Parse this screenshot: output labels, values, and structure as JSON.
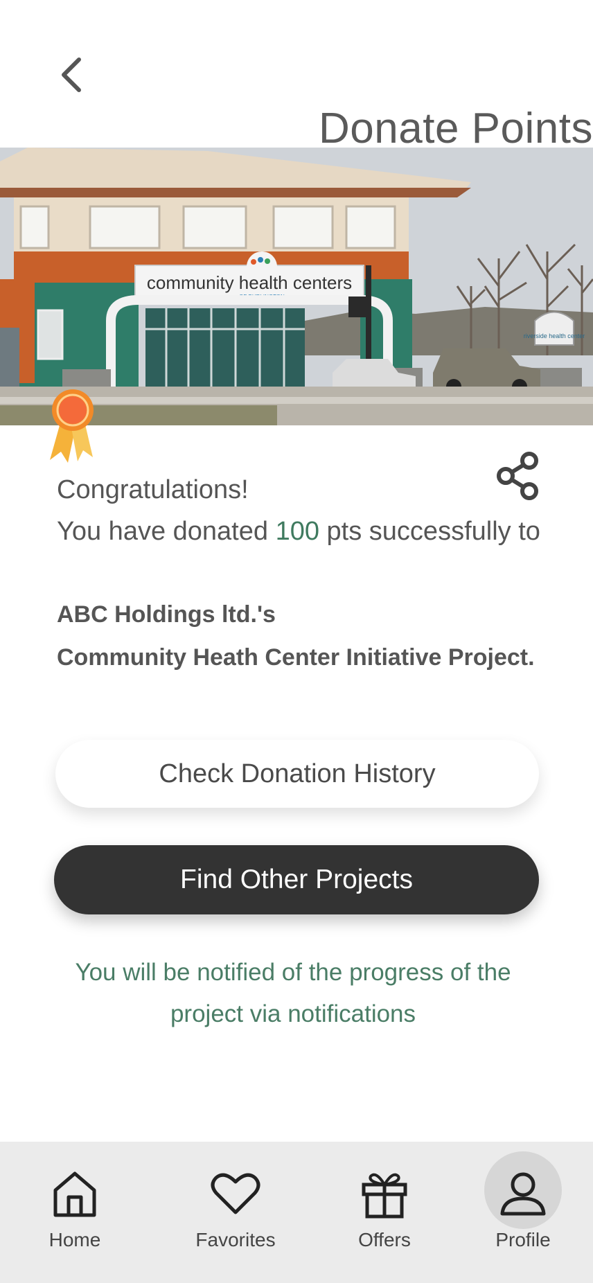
{
  "header": {
    "title": "Donate Points"
  },
  "message": {
    "congrats": "Congratulations!",
    "donated_prefix": "You have donated",
    "points": "100",
    "donated_suffix": "pts successfully to",
    "org": "ABC Holdings ltd.'s",
    "project": "Community Heath Center Initiative Project."
  },
  "hero": {
    "sign_text": "community health centers",
    "sign_sub": "OF BURLINGTON",
    "side_sign": "riverside health center"
  },
  "buttons": {
    "history": "Check Donation History",
    "find": "Find Other Projects"
  },
  "notice": "You will be notified of the progress of the project via notifications",
  "nav": {
    "items": [
      {
        "label": "Home",
        "icon": "home-icon"
      },
      {
        "label": "Favorites",
        "icon": "heart-icon"
      },
      {
        "label": "Offers",
        "icon": "gift-icon"
      },
      {
        "label": "Profile",
        "icon": "user-icon",
        "active": true
      }
    ]
  },
  "colors": {
    "accent_green": "#3f7a5f",
    "dark_button": "#333333",
    "nav_bg": "#ebebeb"
  }
}
